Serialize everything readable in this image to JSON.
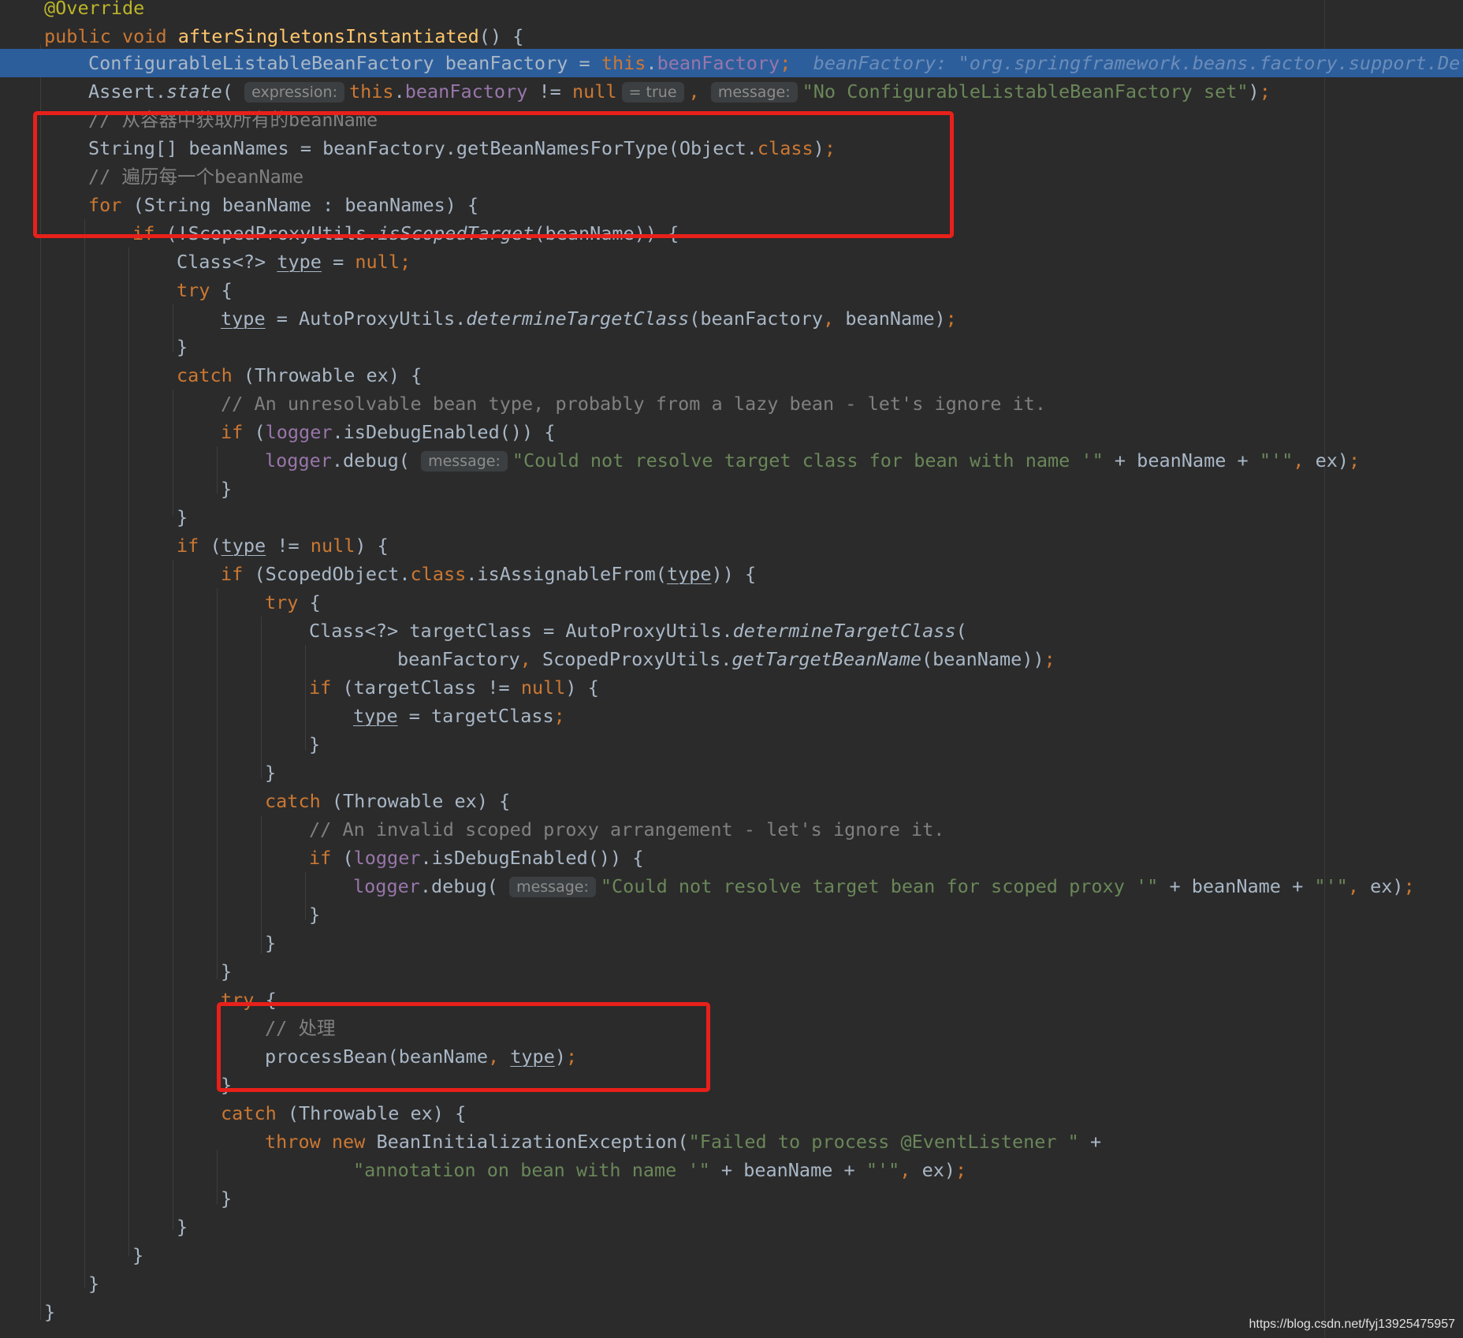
{
  "editor": {
    "lines": [
      "@Override",
      "public void afterSingletonsInstantiated() {",
      "ConfigurableListableBeanFactory beanFactory = this.beanFactory;",
      "Assert.state( this.beanFactory != null , \"No ConfigurableListableBeanFactory set\");",
      "// 从容器中获取所有的beanName",
      "String[] beanNames = beanFactory.getBeanNamesForType(Object.class);",
      "// 遍历每一个beanName",
      "for (String beanName : beanNames) {",
      "if (!ScopedProxyUtils.isScopedTarget(beanName)) {",
      "Class<?> type = null;",
      "try {",
      "type = AutoProxyUtils.determineTargetClass(beanFactory, beanName);",
      "}",
      "catch (Throwable ex) {",
      "// An unresolvable bean type, probably from a lazy bean - let's ignore it.",
      "if (logger.isDebugEnabled()) {",
      "logger.debug( \"Could not resolve target class for bean with name '\" + beanName + \"'\", ex);",
      "}",
      "}",
      "if (type != null) {",
      "if (ScopedObject.class.isAssignableFrom(type)) {",
      "try {",
      "Class<?> targetClass = AutoProxyUtils.determineTargetClass(",
      "beanFactory, ScopedProxyUtils.getTargetBeanName(beanName));",
      "if (targetClass != null) {",
      "type = targetClass;",
      "}",
      "}",
      "catch (Throwable ex) {",
      "// An invalid scoped proxy arrangement - let's ignore it.",
      "if (logger.isDebugEnabled()) {",
      "logger.debug( \"Could not resolve target bean for scoped proxy '\" + beanName + \"'\", ex);",
      "}",
      "}",
      "}",
      "try {",
      "// 处理",
      "processBean(beanName, type);",
      "}",
      "catch (Throwable ex) {",
      "throw new BeanInitializationException(\"Failed to process @EventListener \" +",
      "\"annotation on bean with name '\" + beanName + \"'\", ex);",
      "}",
      "}",
      "}",
      "}",
      "}"
    ],
    "inline_values": {
      "beanFactory": "beanFactory: \"org.springframework.beans.factory.support.Defa",
      "assert_result": "= true"
    },
    "param_hints": {
      "expression": "expression:",
      "message": "message:"
    }
  },
  "watermark": "https://blog.csdn.net/fyj13925475957",
  "colors": {
    "background": "#2b2b2b",
    "current_line": "#2d5e9c",
    "highlight_box": "#e8201a",
    "keyword": "#cc7832",
    "string": "#6a8759",
    "comment": "#808080",
    "field": "#9876aa",
    "method_decl": "#ffc66d",
    "annotation": "#bbb529"
  }
}
